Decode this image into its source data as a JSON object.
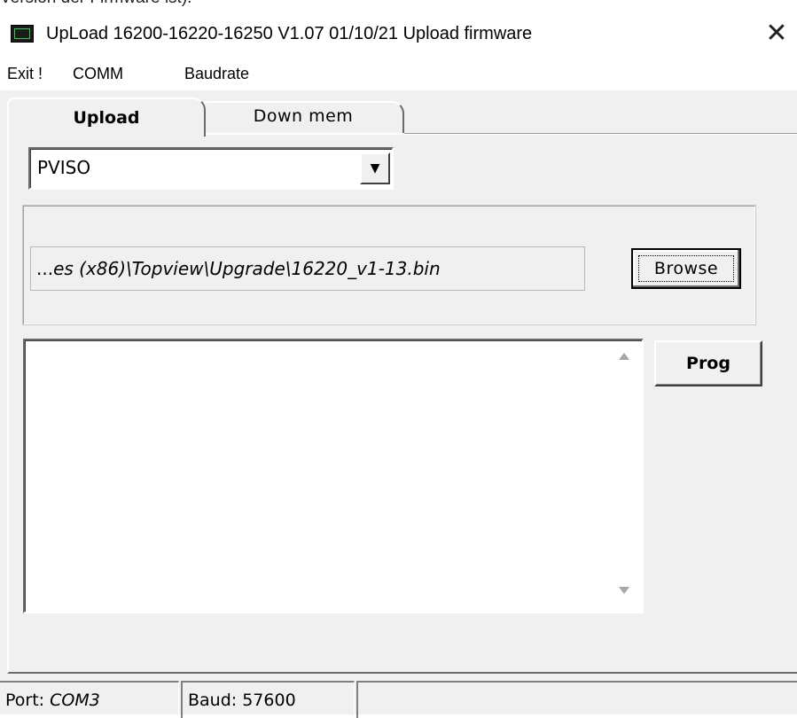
{
  "window": {
    "title": "UpLoad 16200-16220-16250  V1.07  01/10/21  Upload firmware",
    "close_glyph": "✕",
    "top_snippet": "Version der Firmware ist)."
  },
  "menu": {
    "items": [
      "Exit !",
      "COMM",
      "Baudrate"
    ]
  },
  "tabs": [
    {
      "label": "Upload",
      "active": true
    },
    {
      "label": "Down mem",
      "active": false
    }
  ],
  "device_select": {
    "value": "PVISO",
    "arrow_glyph": "▼"
  },
  "file_path": {
    "prefix": "...",
    "value": "es (x86)\\Topview\\Upgrade\\16220_v1-13.bin"
  },
  "buttons": {
    "browse": "Browse",
    "prog": "Prog"
  },
  "log_area": {
    "value": ""
  },
  "status": {
    "port_label": "Port: ",
    "port_value": "COM3",
    "baud_label": "Baud: 57600",
    "extra": ""
  },
  "colors": {
    "face": "#f0f0f0",
    "shadow": "#6a6a6a",
    "highlight": "#ffffff",
    "icon_green": "#39c94a"
  },
  "icons": {
    "app": "app-monitor-icon",
    "close": "close-icon",
    "dropdown": "chevron-down-icon",
    "scroll_up": "scroll-up-arrow-icon",
    "scroll_down": "scroll-down-arrow-icon"
  }
}
